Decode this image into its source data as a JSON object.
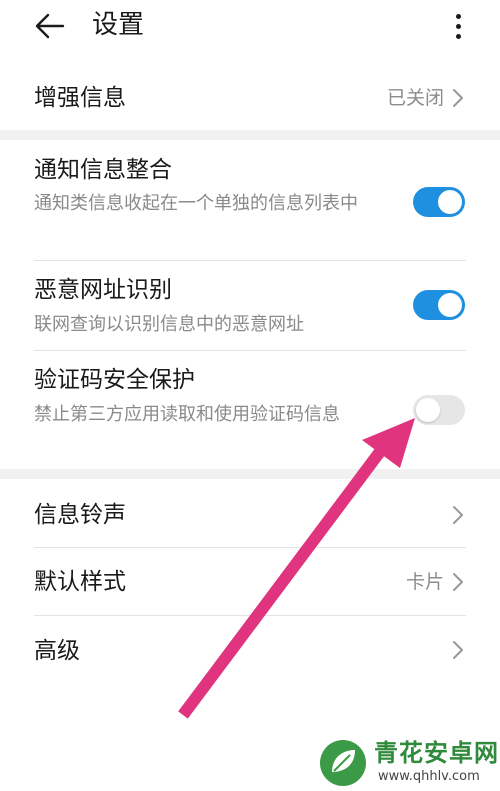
{
  "header": {
    "title": "设置",
    "back_icon": "arrow-left-icon",
    "more_icon": "more-vertical-icon"
  },
  "rows": {
    "enhanced": {
      "label": "增强信息",
      "value": "已关闭"
    },
    "notify_merge": {
      "label": "通知信息整合",
      "desc": "通知类信息收起在一个单独的信息列表中",
      "enabled": true
    },
    "malicious_url": {
      "label": "恶意网址识别",
      "desc": "联网查询以识别信息中的恶意网址",
      "enabled": true
    },
    "code_protect": {
      "label": "验证码安全保护",
      "desc": "禁止第三方应用读取和使用验证码信息",
      "enabled": false
    },
    "ringtone": {
      "label": "信息铃声"
    },
    "default_style": {
      "label": "默认样式",
      "value": "卡片"
    },
    "advanced": {
      "label": "高级"
    }
  },
  "colors": {
    "toggle_on": "#1f8fe0",
    "toggle_off": "#e6e6e6",
    "annotation_arrow": "#e0357e"
  },
  "watermark": {
    "name": "青花安卓网",
    "url": "www.qhhlv.com"
  }
}
